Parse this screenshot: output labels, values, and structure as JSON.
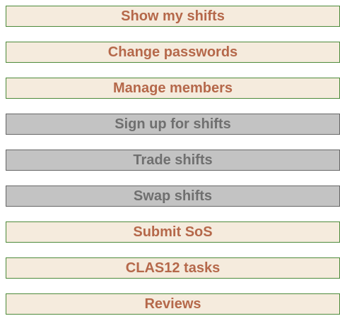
{
  "menu": {
    "items": [
      {
        "label": "Show my shifts",
        "state": "enabled"
      },
      {
        "label": "Change passwords",
        "state": "enabled"
      },
      {
        "label": "Manage members",
        "state": "enabled"
      },
      {
        "label": "Sign up for shifts",
        "state": "disabled"
      },
      {
        "label": "Trade shifts",
        "state": "disabled"
      },
      {
        "label": "Swap shifts",
        "state": "disabled"
      },
      {
        "label": "Submit SoS",
        "state": "enabled"
      },
      {
        "label": "CLAS12 tasks",
        "state": "enabled"
      },
      {
        "label": "Reviews",
        "state": "enabled"
      }
    ]
  },
  "colors": {
    "enabled_background": "#f5ebdd",
    "enabled_border": "#4d8a3a",
    "enabled_text": "#b5684a",
    "disabled_background": "#c3c3c3",
    "disabled_border": "#666666",
    "disabled_text": "#6f6f6f"
  }
}
